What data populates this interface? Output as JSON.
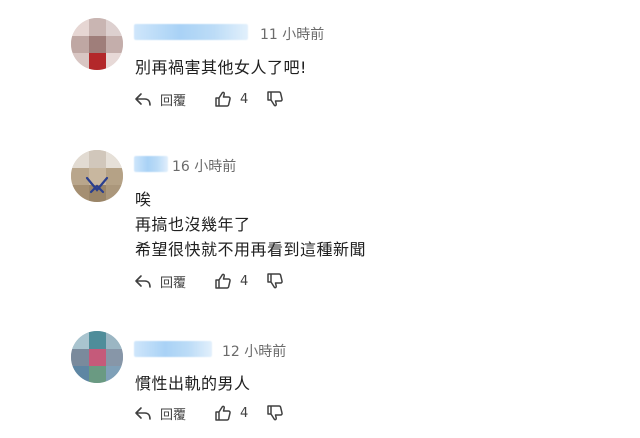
{
  "comments": [
    {
      "time": "11 小時前",
      "lines": [
        "別再禍害其他女人了吧!"
      ],
      "reply_label": "回覆",
      "like_count": "4"
    },
    {
      "time": "16 小時前",
      "lines": [
        "唉",
        "再搞也沒幾年了",
        "希望很快就不用再看到這種新聞"
      ],
      "reply_label": "回覆",
      "like_count": "4"
    },
    {
      "time": "12 小時前",
      "lines": [
        "慣性出軌的男人"
      ],
      "reply_label": "回覆",
      "like_count": "4"
    }
  ],
  "icons": {
    "reply": "reply-arrow-icon",
    "like": "thumbs-up-icon",
    "dislike": "thumbs-down-icon"
  },
  "colors": {
    "name_blur": "#a9d2f6",
    "time_text": "#6b6b6b",
    "body_text": "#202020"
  }
}
